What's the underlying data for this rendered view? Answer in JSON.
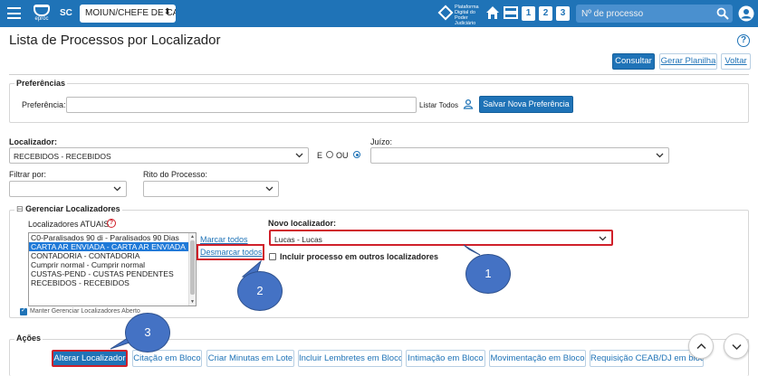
{
  "header": {
    "uf": "SC",
    "profile_select": "MOIUN/CHEFE DE CA",
    "pdpj_logo_line1": "Plataforma",
    "pdpj_logo_line2": "Digital do",
    "pdpj_logo_line3": "Poder Judiciário",
    "eproc_logo": "eproc",
    "quick_buttons": [
      "1",
      "2",
      "3"
    ],
    "search_placeholder": "Nº de processo"
  },
  "page": {
    "title": "Lista de Processos por Localizador",
    "help": "?"
  },
  "toolbar": {
    "consultar": "Consultar",
    "gerar_planilha": "Gerar Planilha",
    "voltar": "Voltar"
  },
  "preferencias": {
    "legend": "Preferências",
    "label": "Preferência:",
    "value": "",
    "listar_todos": "Listar Todos",
    "salvar": "Salvar Nova Preferência"
  },
  "filters": {
    "localizador_label": "Localizador:",
    "localizador_value": "RECEBIDOS - RECEBIDOS",
    "e_label": "E",
    "ou_label": "OU",
    "juizo_label": "Juízo:",
    "juizo_value": "",
    "filtrar_label": "Filtrar por:",
    "filtrar_value": "",
    "rito_label": "Rito do Processo:",
    "rito_value": ""
  },
  "gerenciar": {
    "legend": "Gerenciar Localizadores",
    "toggle": "⊟",
    "atuais_label": "Localizadores ATUAIS",
    "options": [
      "C0-Paralisados 90 di - Paralisados 90 Dias",
      "CARTA AR ENVIADA - CARTA AR ENVIADA",
      "CONTADORIA - CONTADORIA",
      "Cumprir normal - Cumprir normal",
      "CUSTAS-PEND - CUSTAS PENDENTES",
      "RECEBIDOS - RECEBIDOS"
    ],
    "selected_index": 1,
    "marcar_todos": "Marcar todos",
    "desmarcar_todos": "Desmarcar todos",
    "novo_label": "Novo localizador:",
    "novo_value": "Lucas - Lucas",
    "incluir_label": "Incluir processo em outros localizadores",
    "manter_label": "Manter Gerenciar Localizadores Aberto"
  },
  "acoes": {
    "legend": "Ações",
    "buttons": [
      "Alterar Localizador",
      "Citação em Bloco",
      "Criar Minutas em Lote",
      "Incluir Lembretes em Bloco",
      "Intimação em Bloco",
      "Movimentação em Bloco",
      "Requisição CEAB/DJ em bloco"
    ]
  },
  "callouts": [
    "1",
    "2",
    "3"
  ],
  "colors": {
    "brand": "#1f73b7",
    "highlight_border": "#d0202a",
    "callout": "#4472c4"
  }
}
